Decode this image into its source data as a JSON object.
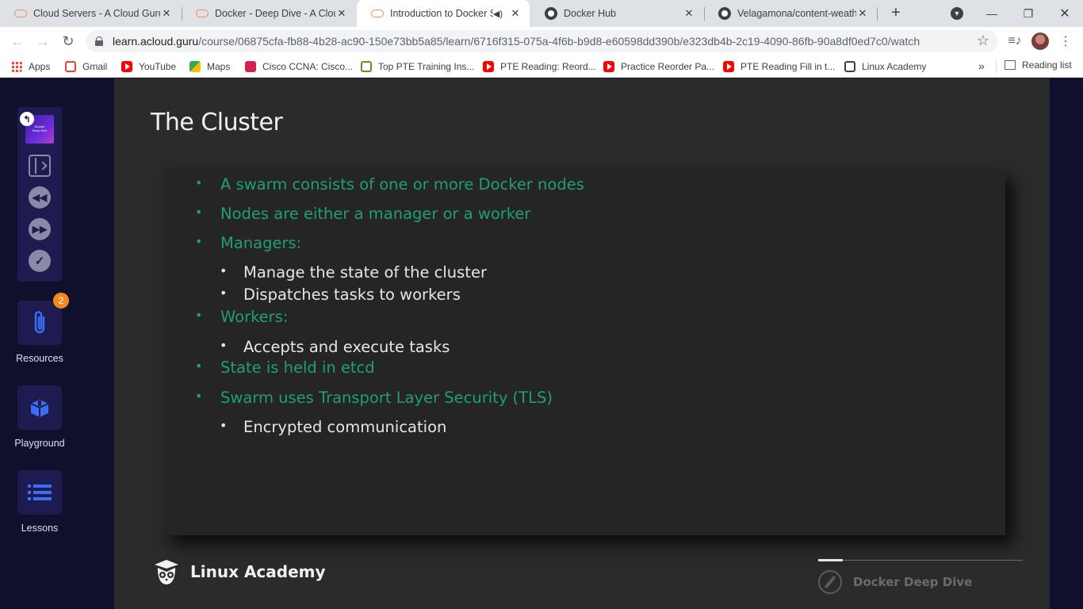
{
  "browser": {
    "tabs": [
      {
        "title": "Cloud Servers - A Cloud Guru",
        "active": false
      },
      {
        "title": "Docker - Deep Dive - A Cloud",
        "active": false
      },
      {
        "title": "Introduction to Docker S",
        "active": true
      },
      {
        "title": "Docker Hub",
        "active": false
      },
      {
        "title": "Velagamona/content-weathe",
        "active": false
      }
    ],
    "url_host": "learn.acloud.guru",
    "url_path": "/course/06875cfa-fb88-4b28-ac90-150e73bb5a85/learn/6716f315-075a-4f6b-b9d8-e60598dd390b/e323db4b-2c19-4090-86fb-90a8df0ed7c0/watch",
    "bookmarks": [
      {
        "label": "Apps",
        "icon": "apps-icon"
      },
      {
        "label": "Gmail",
        "icon": "gmail-icon"
      },
      {
        "label": "YouTube",
        "icon": "youtube-icon"
      },
      {
        "label": "Maps",
        "icon": "maps-icon"
      },
      {
        "label": "Cisco CCNA: Cisco...",
        "icon": "cisco-icon"
      },
      {
        "label": "Top PTE Training Ins...",
        "icon": "pte-icon"
      },
      {
        "label": "PTE Reading: Reord...",
        "icon": "youtube-icon"
      },
      {
        "label": "Practice Reorder Pa...",
        "icon": "youtube-icon"
      },
      {
        "label": "PTE Reading Fill in t...",
        "icon": "youtube-icon"
      },
      {
        "label": "Linux Academy",
        "icon": "linux-academy-icon"
      }
    ],
    "overflow_label": "»",
    "reading_list": "Reading list"
  },
  "sidebar": {
    "thumbnail_text": "Docker Deep Dive",
    "resources_label": "Resources",
    "resources_count": "2",
    "playground_label": "Playground",
    "lessons_label": "Lessons"
  },
  "slide": {
    "title": "The Cluster",
    "bullets": [
      {
        "level": 1,
        "text": "A swarm consists of one or more Docker nodes"
      },
      {
        "level": 1,
        "text": "Nodes are either a manager or a worker"
      },
      {
        "level": 1,
        "text": "Managers:"
      },
      {
        "level": 2,
        "text": "Manage the state of the cluster"
      },
      {
        "level": 2,
        "text": "Dispatches tasks to workers"
      },
      {
        "level": 1,
        "text": "Workers:"
      },
      {
        "level": 2,
        "text": "Accepts and execute tasks"
      },
      {
        "level": 1,
        "text": "State is held in etcd"
      },
      {
        "level": 1,
        "text": "Swarm uses Transport Layer Security (TLS)"
      },
      {
        "level": 2,
        "text": "Encrypted communication"
      }
    ],
    "brand": "Linux Academy",
    "course_name": "Docker Deep Dive",
    "progress": 0.12
  },
  "colors": {
    "accent_green": "#1f9e79",
    "sidebar_bg": "#11102c",
    "tile_bg": "#1d1b4f",
    "badge_orange": "#f5871f"
  }
}
